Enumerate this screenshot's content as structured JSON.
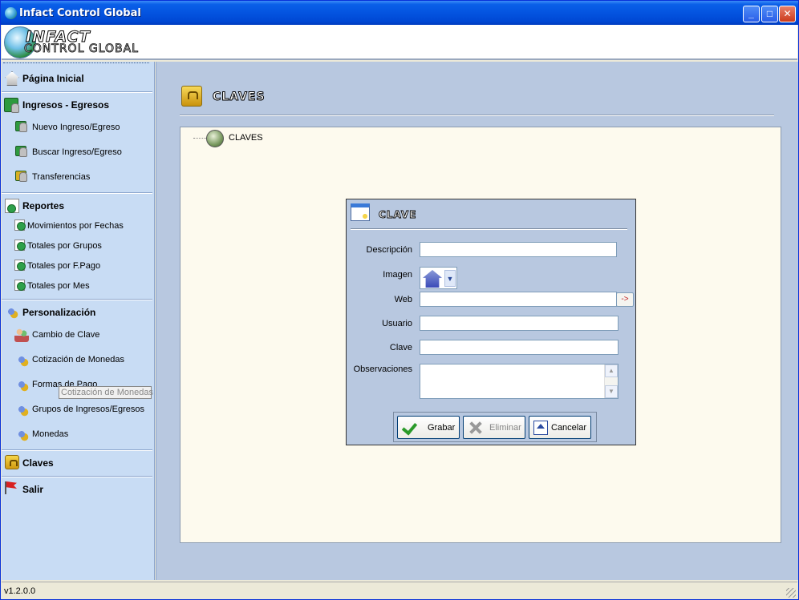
{
  "window": {
    "title": "Infact Control Global",
    "minimize": "_",
    "maximize": "□",
    "close": "✕"
  },
  "header": {
    "logo_line1": "INFACT",
    "logo_line2": "CONTROL GLOBAL"
  },
  "sidebar": {
    "sections": [
      {
        "label": "Página Inicial",
        "icon": "home-icon"
      },
      {
        "label": "Ingresos - Egresos",
        "icon": "money-icon",
        "items": [
          "Nuevo Ingreso/Egreso",
          "Buscar Ingreso/Egreso",
          "Transferencias"
        ]
      },
      {
        "label": "Reportes",
        "icon": "report-icon",
        "items": [
          "Movimientos por Fechas",
          "Totales por Grupos",
          "Totales por F.Pago",
          "Totales por Mes"
        ]
      },
      {
        "label": "Personalización",
        "icon": "gears-icon",
        "items": [
          "Cambio de Clave",
          "Cotización de Monedas",
          "Formas de Pago",
          "Grupos de Ingresos/Egresos",
          "Monedas"
        ]
      },
      {
        "label": "Claves",
        "icon": "lock-icon"
      },
      {
        "label": "Salir",
        "icon": "flag-icon"
      }
    ],
    "tooltip": "Cotización de Monedas"
  },
  "main": {
    "page_title": "CLAVES",
    "tree_root": "CLAVES"
  },
  "dialog": {
    "title": "CLAVE",
    "fields": {
      "descripcion": {
        "label": "Descripción",
        "value": ""
      },
      "imagen": {
        "label": "Imagen",
        "value": "house-image"
      },
      "web": {
        "label": "Web",
        "value": ""
      },
      "usuario": {
        "label": "Usuario",
        "value": ""
      },
      "clave": {
        "label": "Clave",
        "value": ""
      },
      "observaciones": {
        "label": "Observaciones",
        "value": ""
      }
    },
    "go_label": "->",
    "buttons": {
      "save": "Grabar",
      "delete": "Eliminar",
      "cancel": "Cancelar"
    }
  },
  "statusbar": {
    "version": "v1.2.0.0"
  }
}
